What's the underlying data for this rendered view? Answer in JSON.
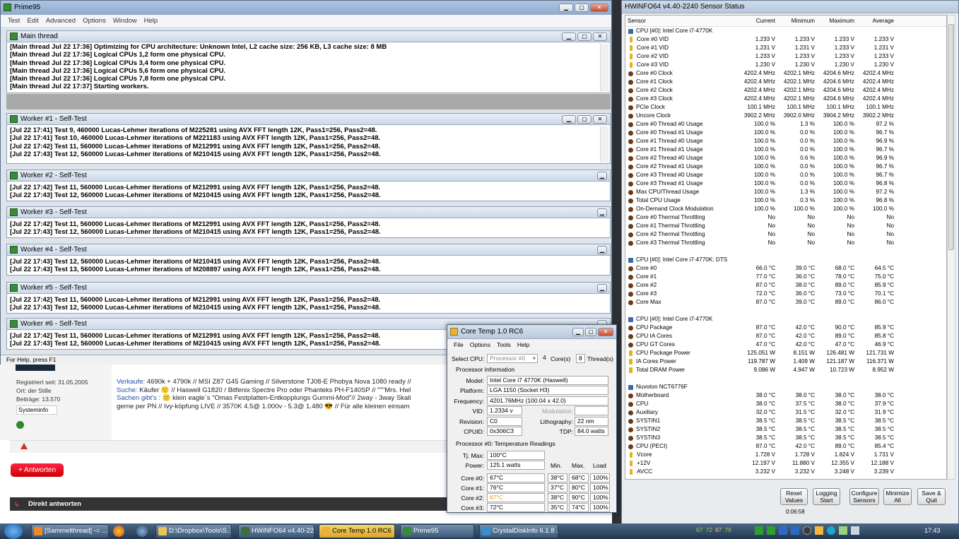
{
  "prime95": {
    "title": "Prime95",
    "menu": [
      "Test",
      "Edit",
      "Advanced",
      "Options",
      "Window",
      "Help"
    ],
    "status": "For Help, press F1",
    "main": {
      "title": "Main thread",
      "lines": [
        "[Main thread Jul 22 17:36] Optimizing for CPU architecture: Unknown Intel, L2 cache size: 256 KB, L3 cache size: 8 MB",
        "[Main thread Jul 22 17:36] Logical CPUs 1,2 form one physical CPU.",
        "[Main thread Jul 22 17:36] Logical CPUs 3,4 form one physical CPU.",
        "[Main thread Jul 22 17:36] Logical CPUs 5,6 form one physical CPU.",
        "[Main thread Jul 22 17:36] Logical CPUs 7,8 form one physical CPU.",
        "[Main thread Jul 22 17:37] Starting workers."
      ]
    },
    "workers": [
      {
        "title": "Worker #1 - Self-Test",
        "lines": [
          "[Jul 22 17:41] Test 9, 460000 Lucas-Lehmer iterations of M225281 using AVX FFT length 12K, Pass1=256, Pass2=48.",
          "[Jul 22 17:41] Test 10, 460000 Lucas-Lehmer iterations of M221183 using AVX FFT length 12K, Pass1=256, Pass2=48.",
          "[Jul 22 17:42] Test 11, 560000 Lucas-Lehmer iterations of M212991 using AVX FFT length 12K, Pass1=256, Pass2=48.",
          "[Jul 22 17:43] Test 12, 560000 Lucas-Lehmer iterations of M210415 using AVX FFT length 12K, Pass1=256, Pass2=48."
        ]
      },
      {
        "title": "Worker #2 - Self-Test",
        "lines": [
          "[Jul 22 17:42] Test 11, 560000 Lucas-Lehmer iterations of M212991 using AVX FFT length 12K, Pass1=256, Pass2=48.",
          "[Jul 22 17:43] Test 12, 560000 Lucas-Lehmer iterations of M210415 using AVX FFT length 12K, Pass1=256, Pass2=48."
        ]
      },
      {
        "title": "Worker #3 - Self-Test",
        "lines": [
          "[Jul 22 17:42] Test 11, 560000 Lucas-Lehmer iterations of M212991 using AVX FFT length 12K, Pass1=256, Pass2=48.",
          "[Jul 22 17:43] Test 12, 560000 Lucas-Lehmer iterations of M210415 using AVX FFT length 12K, Pass1=256, Pass2=48."
        ]
      },
      {
        "title": "Worker #4 - Self-Test",
        "lines": [
          "[Jul 22 17:43] Test 12, 560000 Lucas-Lehmer iterations of M210415 using AVX FFT length 12K, Pass1=256, Pass2=48.",
          "[Jul 22 17:43] Test 13, 560000 Lucas-Lehmer iterations of M208897 using AVX FFT length 12K, Pass1=256, Pass2=48."
        ]
      },
      {
        "title": "Worker #5 - Self-Test",
        "lines": [
          "[Jul 22 17:42] Test 11, 560000 Lucas-Lehmer iterations of M212991 using AVX FFT length 12K, Pass1=256, Pass2=48.",
          "[Jul 22 17:43] Test 12, 560000 Lucas-Lehmer iterations of M210415 using AVX FFT length 12K, Pass1=256, Pass2=48."
        ]
      },
      {
        "title": "Worker #6 - Self-Test",
        "lines": [
          "[Jul 22 17:42] Test 11, 560000 Lucas-Lehmer iterations of M212991 using AVX FFT length 12K, Pass1=256, Pass2=48.",
          "[Jul 22 17:43] Test 12, 560000 Lucas-Lehmer iterations of M210415 using AVX FFT length 12K, Pass1=256, Pass2=48."
        ]
      }
    ]
  },
  "forum": {
    "registered": "Registriert seit: 31.05.2005",
    "location": "Ort: der Stille",
    "posts": "Beiträge: 13.570",
    "sysinfo_btn": "Systeminfo",
    "sig1_label": "Verkaufe:",
    "sig1": " 4690k + 4790k // MSI Z87 G45 Gaming // Silverstone TJ08-E Phobya Nova 1080 ready //",
    "sig2_label": "Suche:",
    "sig2": " Käufer 🙂 // Haswell G1820 / Bitfenix Spectre Pro oder Phanteks PH-F140SP // \"\"\"Mrs. Hwl",
    "sig3_label": "Sachen gibt's :",
    "sig3": " 🙂 klein eagle`s \"Omas Festplatten-Entkopplungs Gummi-Mod\"// 2way - 3way Skali",
    "sig4": "gerne per PN // Ivy-köpfung LIVE // 3570K 4.5@ 1.000v - 5.3@ 1.480 😎 // Für alle kleinen einsam",
    "reply_btn": "+ Antworten",
    "quick_reply": "Direkt antworten"
  },
  "hwinfo": {
    "title": "HWiNFO64 v4.40-2240 Sensor Status",
    "columns": [
      "Sensor",
      "Current",
      "Minimum",
      "Maximum",
      "Average"
    ],
    "rows": [
      {
        "t": "g",
        "n": "CPU [#0]: Intel Core i7-4770K"
      },
      {
        "t": "v",
        "n": "Core #0 VID",
        "c": "1.233 V",
        "mi": "1.233 V",
        "ma": "1.233 V",
        "a": "1.233 V"
      },
      {
        "t": "v",
        "n": "Core #1 VID",
        "c": "1.231 V",
        "mi": "1.231 V",
        "ma": "1.233 V",
        "a": "1.231 V"
      },
      {
        "t": "v",
        "n": "Core #2 VID",
        "c": "1.233 V",
        "mi": "1.233 V",
        "ma": "1.233 V",
        "a": "1.233 V"
      },
      {
        "t": "v",
        "n": "Core #3 VID",
        "c": "1.230 V",
        "mi": "1.230 V",
        "ma": "1.230 V",
        "a": "1.230 V"
      },
      {
        "t": "o",
        "n": "Core #0 Clock",
        "c": "4202.4 MHz",
        "mi": "4202.1 MHz",
        "ma": "4204.6 MHz",
        "a": "4202.4 MHz"
      },
      {
        "t": "o",
        "n": "Core #1 Clock",
        "c": "4202.4 MHz",
        "mi": "4202.1 MHz",
        "ma": "4204.6 MHz",
        "a": "4202.4 MHz"
      },
      {
        "t": "o",
        "n": "Core #2 Clock",
        "c": "4202.4 MHz",
        "mi": "4202.1 MHz",
        "ma": "4204.6 MHz",
        "a": "4202.4 MHz"
      },
      {
        "t": "o",
        "n": "Core #3 Clock",
        "c": "4202.4 MHz",
        "mi": "4202.1 MHz",
        "ma": "4204.6 MHz",
        "a": "4202.4 MHz"
      },
      {
        "t": "o",
        "n": "PCIe Clock",
        "c": "100.1 MHz",
        "mi": "100.1 MHz",
        "ma": "100.1 MHz",
        "a": "100.1 MHz"
      },
      {
        "t": "o",
        "n": "Uncore Clock",
        "c": "3902.2 MHz",
        "mi": "3902.0 MHz",
        "ma": "3904.2 MHz",
        "a": "3902.2 MHz"
      },
      {
        "t": "o",
        "n": "Core #0 Thread #0 Usage",
        "c": "100.0 %",
        "mi": "1.3 %",
        "ma": "100.0 %",
        "a": "97.2 %"
      },
      {
        "t": "o",
        "n": "Core #0 Thread #1 Usage",
        "c": "100.0 %",
        "mi": "0.0 %",
        "ma": "100.0 %",
        "a": "96.7 %"
      },
      {
        "t": "o",
        "n": "Core #1 Thread #0 Usage",
        "c": "100.0 %",
        "mi": "0.0 %",
        "ma": "100.0 %",
        "a": "96.9 %"
      },
      {
        "t": "o",
        "n": "Core #1 Thread #1 Usage",
        "c": "100.0 %",
        "mi": "0.0 %",
        "ma": "100.0 %",
        "a": "96.7 %"
      },
      {
        "t": "o",
        "n": "Core #2 Thread #0 Usage",
        "c": "100.0 %",
        "mi": "0.6 %",
        "ma": "100.0 %",
        "a": "96.9 %"
      },
      {
        "t": "o",
        "n": "Core #2 Thread #1 Usage",
        "c": "100.0 %",
        "mi": "0.0 %",
        "ma": "100.0 %",
        "a": "96.7 %"
      },
      {
        "t": "o",
        "n": "Core #3 Thread #0 Usage",
        "c": "100.0 %",
        "mi": "0.0 %",
        "ma": "100.0 %",
        "a": "96.7 %"
      },
      {
        "t": "o",
        "n": "Core #3 Thread #1 Usage",
        "c": "100.0 %",
        "mi": "0.0 %",
        "ma": "100.0 %",
        "a": "96.8 %"
      },
      {
        "t": "o",
        "n": "Max CPU/Thread Usage",
        "c": "100.0 %",
        "mi": "1.3 %",
        "ma": "100.0 %",
        "a": "97.2 %"
      },
      {
        "t": "o",
        "n": "Total CPU Usage",
        "c": "100.0 %",
        "mi": "0.3 %",
        "ma": "100.0 %",
        "a": "96.8 %"
      },
      {
        "t": "o",
        "n": "On-Demand Clock Modulation",
        "c": "100.0 %",
        "mi": "100.0 %",
        "ma": "100.0 %",
        "a": "100.0 %"
      },
      {
        "t": "o",
        "n": "Core #0 Thermal Throttling",
        "c": "No",
        "mi": "No",
        "ma": "No",
        "a": "No"
      },
      {
        "t": "o",
        "n": "Core #1 Thermal Throttling",
        "c": "No",
        "mi": "No",
        "ma": "No",
        "a": "No"
      },
      {
        "t": "o",
        "n": "Core #2 Thermal Throttling",
        "c": "No",
        "mi": "No",
        "ma": "No",
        "a": "No"
      },
      {
        "t": "o",
        "n": "Core #3 Thermal Throttling",
        "c": "No",
        "mi": "No",
        "ma": "No",
        "a": "No"
      },
      {
        "t": "b"
      },
      {
        "t": "g",
        "n": "CPU [#0]: Intel Core i7-4770K: DTS"
      },
      {
        "t": "o",
        "n": "Core #0",
        "c": "66.0 °C",
        "mi": "39.0 °C",
        "ma": "68.0 °C",
        "a": "64.5 °C"
      },
      {
        "t": "o",
        "n": "Core #1",
        "c": "77.0 °C",
        "mi": "36.0 °C",
        "ma": "78.0 °C",
        "a": "75.0 °C"
      },
      {
        "t": "o",
        "n": "Core #2",
        "c": "87.0 °C",
        "mi": "38.0 °C",
        "ma": "89.0 °C",
        "a": "85.9 °C"
      },
      {
        "t": "o",
        "n": "Core #3",
        "c": "72.0 °C",
        "mi": "36.0 °C",
        "ma": "73.0 °C",
        "a": "70.1 °C"
      },
      {
        "t": "o",
        "n": "Core Max",
        "c": "87.0 °C",
        "mi": "39.0 °C",
        "ma": "89.0 °C",
        "a": "86.0 °C"
      },
      {
        "t": "b"
      },
      {
        "t": "g",
        "n": "CPU [#0]: Intel Core i7-4770K"
      },
      {
        "t": "o",
        "n": "CPU Package",
        "c": "87.0 °C",
        "mi": "42.0 °C",
        "ma": "90.0 °C",
        "a": "85.9 °C"
      },
      {
        "t": "o",
        "n": "CPU IA Cores",
        "c": "87.0 °C",
        "mi": "42.0 °C",
        "ma": "89.0 °C",
        "a": "85.8 °C"
      },
      {
        "t": "o",
        "n": "CPU GT Cores",
        "c": "47.0 °C",
        "mi": "42.0 °C",
        "ma": "47.0 °C",
        "a": "46.9 °C"
      },
      {
        "t": "p",
        "n": "CPU Package Power",
        "c": "125.051 W",
        "mi": "8.151 W",
        "ma": "126.481 W",
        "a": "121.731 W"
      },
      {
        "t": "p",
        "n": "IA Cores Power",
        "c": "119.787 W",
        "mi": "1.409 W",
        "ma": "121.187 W",
        "a": "116.371 W"
      },
      {
        "t": "p",
        "n": "Total DRAM Power",
        "c": "9.086 W",
        "mi": "4.947 W",
        "ma": "10.723 W",
        "a": "8.952 W"
      },
      {
        "t": "b"
      },
      {
        "t": "g",
        "n": "Nuvoton NCT6776F"
      },
      {
        "t": "o",
        "n": "Motherboard",
        "c": "38.0 °C",
        "mi": "38.0 °C",
        "ma": "38.0 °C",
        "a": "38.0 °C"
      },
      {
        "t": "o",
        "n": "CPU",
        "c": "38.0 °C",
        "mi": "37.5 °C",
        "ma": "38.0 °C",
        "a": "37.9 °C"
      },
      {
        "t": "o",
        "n": "Auxiliary",
        "c": "32.0 °C",
        "mi": "31.5 °C",
        "ma": "32.0 °C",
        "a": "31.9 °C"
      },
      {
        "t": "o",
        "n": "SYSTIN1",
        "c": "38.5 °C",
        "mi": "38.5 °C",
        "ma": "38.5 °C",
        "a": "38.5 °C"
      },
      {
        "t": "o",
        "n": "SYSTIN2",
        "c": "38.5 °C",
        "mi": "38.5 °C",
        "ma": "38.5 °C",
        "a": "38.5 °C"
      },
      {
        "t": "o",
        "n": "SYSTIN3",
        "c": "38.5 °C",
        "mi": "38.5 °C",
        "ma": "38.5 °C",
        "a": "38.5 °C"
      },
      {
        "t": "o",
        "n": "CPU (PECI)",
        "c": "87.0 °C",
        "mi": "42.0 °C",
        "ma": "89.0 °C",
        "a": "85.4 °C"
      },
      {
        "t": "v",
        "n": "Vcore",
        "c": "1.728 V",
        "mi": "1.728 V",
        "ma": "1.824 V",
        "a": "1.731 V"
      },
      {
        "t": "v",
        "n": "+12V",
        "c": "12.197 V",
        "mi": "11.880 V",
        "ma": "12.355 V",
        "a": "12.188 V"
      },
      {
        "t": "v",
        "n": "AVCC",
        "c": "3.232 V",
        "mi": "3.232 V",
        "ma": "3.248 V",
        "a": "3.239 V"
      }
    ],
    "elapsed": "0:06:58",
    "buttons": [
      "Reset Values",
      "Logging Start",
      "Configure Sensors",
      "Minimize All",
      "Save & Quit"
    ]
  },
  "coretemp": {
    "title": "Core Temp 1.0 RC6",
    "menu": [
      "File",
      "Options",
      "Tools",
      "Help"
    ],
    "select_cpu_label": "Select CPU:",
    "select_cpu": "Processor #0",
    "cores": "4",
    "cores_label": "Core(s)",
    "threads": "8",
    "threads_label": "Thread(s)",
    "info_header": "Processor Information",
    "model_label": "Model:",
    "model": "Intel Core i7 4770K (Haswell)",
    "platform_label": "Platform:",
    "platform": "LGA 1150 (Socket H3)",
    "freq_label": "Frequency:",
    "freq": "4201.76MHz (100.04 x 42.0)",
    "vid_label": "VID:",
    "vid": "1.2334 v",
    "mod_label": "Modulation:",
    "mod": "",
    "rev_label": "Revision:",
    "rev": "C0",
    "litho_label": "Lithography:",
    "litho": "22 nm",
    "cpuid_label": "CPUID:",
    "cpuid": "0x306C3",
    "tdp_label": "TDP:",
    "tdp": "84.0 watts",
    "temps_header": "Processor #0: Temperature Readings",
    "tjmax_label": "Tj. Max:",
    "tjmax": "100°C",
    "power_label": "Power:",
    "power": "125.1 watts",
    "col_min": "Min.",
    "col_max": "Max.",
    "col_load": "Load",
    "cores_rows": [
      {
        "label": "Core #0:",
        "temp": "67°C",
        "min": "38°C",
        "max": "68°C",
        "load": "100%"
      },
      {
        "label": "Core #1:",
        "temp": "76°C",
        "min": "37°C",
        "max": "80°C",
        "load": "100%"
      },
      {
        "label": "Core #2:",
        "temp": "87°C",
        "min": "38°C",
        "max": "90°C",
        "load": "100%"
      },
      {
        "label": "Core #3:",
        "temp": "72°C",
        "min": "35°C",
        "max": "74°C",
        "load": "100%"
      }
    ]
  },
  "taskbar": {
    "items": [
      "[Sammelthread] -= ...",
      "D:\\Dropbox\\Tools\\S...",
      "HWiNFO64 v4.40-22...",
      "Core Temp 1.0 RC6",
      "Prime95",
      "CrystalDiskInfo 6.1.8 ..."
    ],
    "tray_temps": [
      "67",
      "72",
      "87",
      "76"
    ],
    "clock": "17:43"
  }
}
